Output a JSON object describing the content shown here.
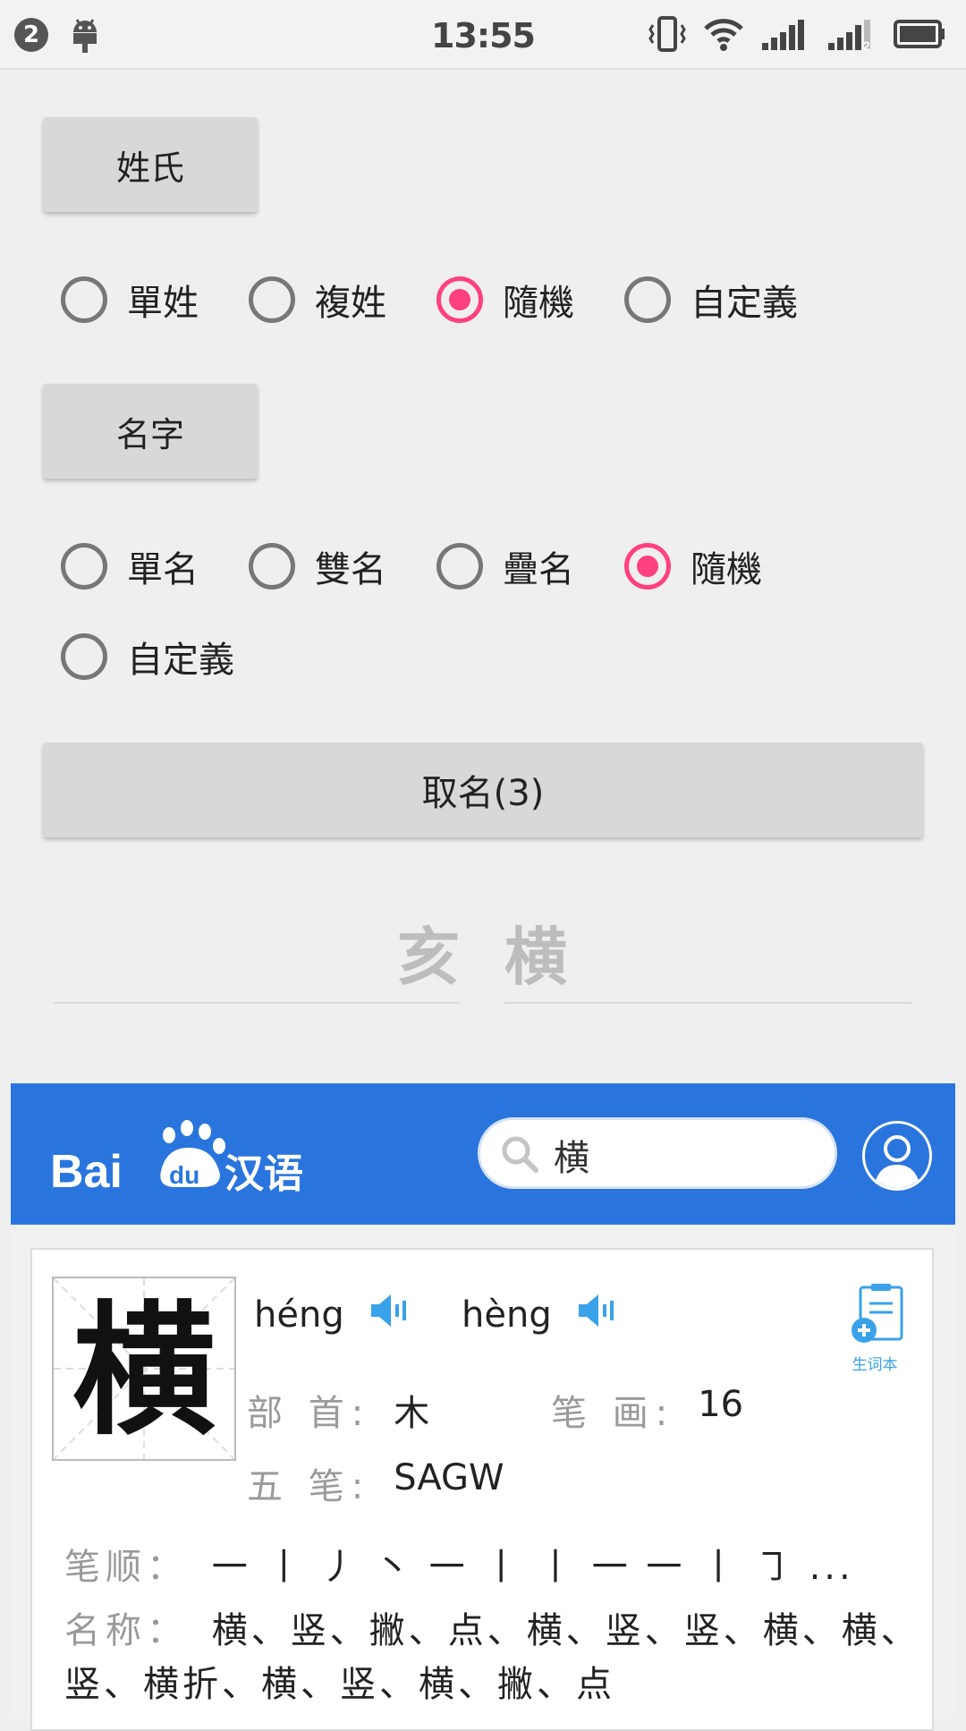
{
  "status_bar": {
    "notification_count": "2",
    "time": "13:55",
    "icons": [
      "android-icon",
      "vibrate-icon",
      "wifi-icon",
      "signal-icon",
      "signal-2-icon",
      "battery-icon"
    ]
  },
  "surname": {
    "button_label": "姓氏",
    "options": [
      {
        "label": "單姓",
        "checked": false
      },
      {
        "label": "複姓",
        "checked": false
      },
      {
        "label": "隨機",
        "checked": true
      },
      {
        "label": "自定義",
        "checked": false
      }
    ]
  },
  "given_name": {
    "button_label": "名字",
    "options": [
      {
        "label": "單名",
        "checked": false
      },
      {
        "label": "雙名",
        "checked": false
      },
      {
        "label": "疊名",
        "checked": false
      },
      {
        "label": "隨機",
        "checked": true
      },
      {
        "label": "自定義",
        "checked": false
      }
    ]
  },
  "generate_button": "取名(3)",
  "result": {
    "surname": "亥",
    "given_name": "横"
  },
  "baidu": {
    "logo_text": "Bai",
    "logo_du": "du",
    "logo_hanyu": "汉语",
    "search_value": "横",
    "character": "横",
    "pinyin": [
      "héng",
      "hèng"
    ],
    "vocab_label": "生词本",
    "radical_label": "部 首:",
    "radical": "木",
    "strokes_label": "笔 画:",
    "stroke_count": "16",
    "wubi_label": "五 笔:",
    "wubi": "SAGW",
    "stroke_order_label": "笔顺：",
    "stroke_order": "一 丨 丿 丶 一 丨 丨 一 一 丨 ㇆ ...",
    "stroke_names_label": "名称：",
    "stroke_names": "横、竖、撇、点、横、竖、竖、横、横、竖、横折、横、竖、横、撇、点"
  },
  "colors": {
    "accent": "#ff4081",
    "baidu_blue": "#2a75dd",
    "speaker_blue": "#3aa2e8"
  }
}
